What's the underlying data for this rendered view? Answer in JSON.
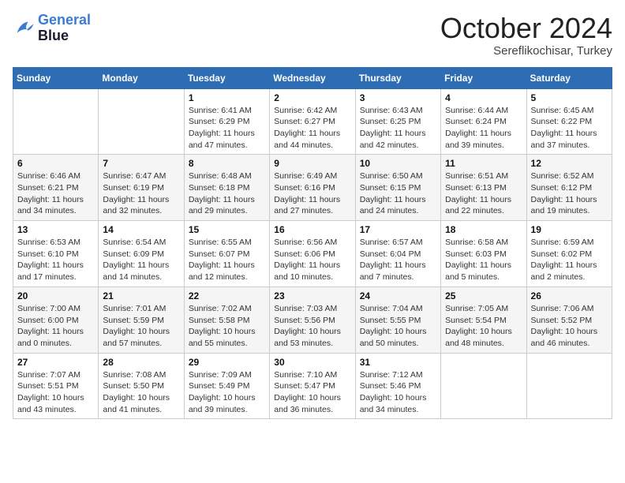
{
  "header": {
    "logo_line1": "General",
    "logo_line2": "Blue",
    "month": "October 2024",
    "location": "Sereflikochisar, Turkey"
  },
  "weekdays": [
    "Sunday",
    "Monday",
    "Tuesday",
    "Wednesday",
    "Thursday",
    "Friday",
    "Saturday"
  ],
  "weeks": [
    [
      {
        "day": "",
        "sunrise": "",
        "sunset": "",
        "daylight": ""
      },
      {
        "day": "",
        "sunrise": "",
        "sunset": "",
        "daylight": ""
      },
      {
        "day": "1",
        "sunrise": "Sunrise: 6:41 AM",
        "sunset": "Sunset: 6:29 PM",
        "daylight": "Daylight: 11 hours and 47 minutes."
      },
      {
        "day": "2",
        "sunrise": "Sunrise: 6:42 AM",
        "sunset": "Sunset: 6:27 PM",
        "daylight": "Daylight: 11 hours and 44 minutes."
      },
      {
        "day": "3",
        "sunrise": "Sunrise: 6:43 AM",
        "sunset": "Sunset: 6:25 PM",
        "daylight": "Daylight: 11 hours and 42 minutes."
      },
      {
        "day": "4",
        "sunrise": "Sunrise: 6:44 AM",
        "sunset": "Sunset: 6:24 PM",
        "daylight": "Daylight: 11 hours and 39 minutes."
      },
      {
        "day": "5",
        "sunrise": "Sunrise: 6:45 AM",
        "sunset": "Sunset: 6:22 PM",
        "daylight": "Daylight: 11 hours and 37 minutes."
      }
    ],
    [
      {
        "day": "6",
        "sunrise": "Sunrise: 6:46 AM",
        "sunset": "Sunset: 6:21 PM",
        "daylight": "Daylight: 11 hours and 34 minutes."
      },
      {
        "day": "7",
        "sunrise": "Sunrise: 6:47 AM",
        "sunset": "Sunset: 6:19 PM",
        "daylight": "Daylight: 11 hours and 32 minutes."
      },
      {
        "day": "8",
        "sunrise": "Sunrise: 6:48 AM",
        "sunset": "Sunset: 6:18 PM",
        "daylight": "Daylight: 11 hours and 29 minutes."
      },
      {
        "day": "9",
        "sunrise": "Sunrise: 6:49 AM",
        "sunset": "Sunset: 6:16 PM",
        "daylight": "Daylight: 11 hours and 27 minutes."
      },
      {
        "day": "10",
        "sunrise": "Sunrise: 6:50 AM",
        "sunset": "Sunset: 6:15 PM",
        "daylight": "Daylight: 11 hours and 24 minutes."
      },
      {
        "day": "11",
        "sunrise": "Sunrise: 6:51 AM",
        "sunset": "Sunset: 6:13 PM",
        "daylight": "Daylight: 11 hours and 22 minutes."
      },
      {
        "day": "12",
        "sunrise": "Sunrise: 6:52 AM",
        "sunset": "Sunset: 6:12 PM",
        "daylight": "Daylight: 11 hours and 19 minutes."
      }
    ],
    [
      {
        "day": "13",
        "sunrise": "Sunrise: 6:53 AM",
        "sunset": "Sunset: 6:10 PM",
        "daylight": "Daylight: 11 hours and 17 minutes."
      },
      {
        "day": "14",
        "sunrise": "Sunrise: 6:54 AM",
        "sunset": "Sunset: 6:09 PM",
        "daylight": "Daylight: 11 hours and 14 minutes."
      },
      {
        "day": "15",
        "sunrise": "Sunrise: 6:55 AM",
        "sunset": "Sunset: 6:07 PM",
        "daylight": "Daylight: 11 hours and 12 minutes."
      },
      {
        "day": "16",
        "sunrise": "Sunrise: 6:56 AM",
        "sunset": "Sunset: 6:06 PM",
        "daylight": "Daylight: 11 hours and 10 minutes."
      },
      {
        "day": "17",
        "sunrise": "Sunrise: 6:57 AM",
        "sunset": "Sunset: 6:04 PM",
        "daylight": "Daylight: 11 hours and 7 minutes."
      },
      {
        "day": "18",
        "sunrise": "Sunrise: 6:58 AM",
        "sunset": "Sunset: 6:03 PM",
        "daylight": "Daylight: 11 hours and 5 minutes."
      },
      {
        "day": "19",
        "sunrise": "Sunrise: 6:59 AM",
        "sunset": "Sunset: 6:02 PM",
        "daylight": "Daylight: 11 hours and 2 minutes."
      }
    ],
    [
      {
        "day": "20",
        "sunrise": "Sunrise: 7:00 AM",
        "sunset": "Sunset: 6:00 PM",
        "daylight": "Daylight: 11 hours and 0 minutes."
      },
      {
        "day": "21",
        "sunrise": "Sunrise: 7:01 AM",
        "sunset": "Sunset: 5:59 PM",
        "daylight": "Daylight: 10 hours and 57 minutes."
      },
      {
        "day": "22",
        "sunrise": "Sunrise: 7:02 AM",
        "sunset": "Sunset: 5:58 PM",
        "daylight": "Daylight: 10 hours and 55 minutes."
      },
      {
        "day": "23",
        "sunrise": "Sunrise: 7:03 AM",
        "sunset": "Sunset: 5:56 PM",
        "daylight": "Daylight: 10 hours and 53 minutes."
      },
      {
        "day": "24",
        "sunrise": "Sunrise: 7:04 AM",
        "sunset": "Sunset: 5:55 PM",
        "daylight": "Daylight: 10 hours and 50 minutes."
      },
      {
        "day": "25",
        "sunrise": "Sunrise: 7:05 AM",
        "sunset": "Sunset: 5:54 PM",
        "daylight": "Daylight: 10 hours and 48 minutes."
      },
      {
        "day": "26",
        "sunrise": "Sunrise: 7:06 AM",
        "sunset": "Sunset: 5:52 PM",
        "daylight": "Daylight: 10 hours and 46 minutes."
      }
    ],
    [
      {
        "day": "27",
        "sunrise": "Sunrise: 7:07 AM",
        "sunset": "Sunset: 5:51 PM",
        "daylight": "Daylight: 10 hours and 43 minutes."
      },
      {
        "day": "28",
        "sunrise": "Sunrise: 7:08 AM",
        "sunset": "Sunset: 5:50 PM",
        "daylight": "Daylight: 10 hours and 41 minutes."
      },
      {
        "day": "29",
        "sunrise": "Sunrise: 7:09 AM",
        "sunset": "Sunset: 5:49 PM",
        "daylight": "Daylight: 10 hours and 39 minutes."
      },
      {
        "day": "30",
        "sunrise": "Sunrise: 7:10 AM",
        "sunset": "Sunset: 5:47 PM",
        "daylight": "Daylight: 10 hours and 36 minutes."
      },
      {
        "day": "31",
        "sunrise": "Sunrise: 7:12 AM",
        "sunset": "Sunset: 5:46 PM",
        "daylight": "Daylight: 10 hours and 34 minutes."
      },
      {
        "day": "",
        "sunrise": "",
        "sunset": "",
        "daylight": ""
      },
      {
        "day": "",
        "sunrise": "",
        "sunset": "",
        "daylight": ""
      }
    ]
  ]
}
